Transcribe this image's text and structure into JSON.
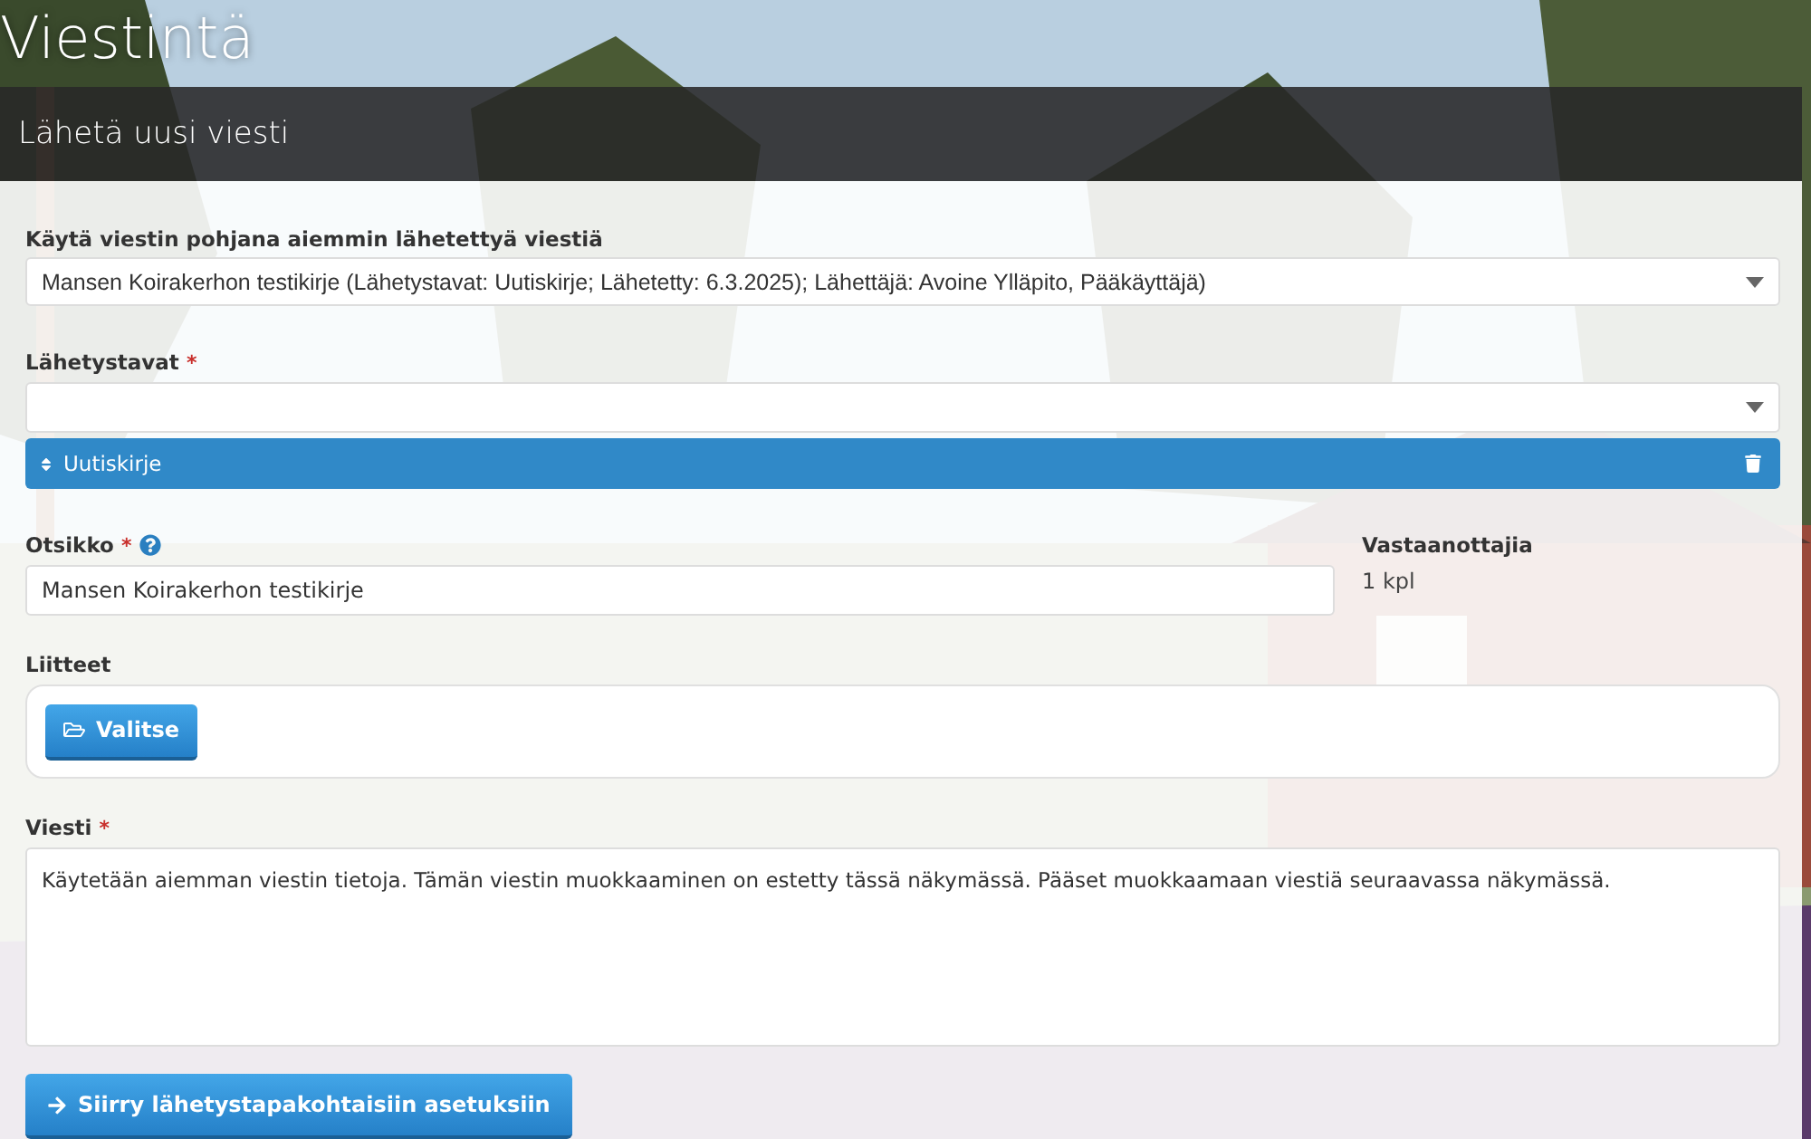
{
  "page_title": "Viestintä",
  "panel": {
    "title": "Lähetä uusi viesti"
  },
  "template_select": {
    "label": "Käytä viestin pohjana aiemmin lähetettyä viestiä",
    "value": "Mansen Koirakerhon testikirje (Lähetystavat: Uutiskirje; Lähetetty: 6.3.2025); Lähettäjä: Avoine Ylläpito, Pääkäyttäjä)"
  },
  "send_methods": {
    "label": "Lähetystavat",
    "required_mark": "*",
    "tags": [
      {
        "label": "Uutiskirje"
      }
    ]
  },
  "subject": {
    "label": "Otsikko",
    "required_mark": "*",
    "help": true,
    "value": "Mansen Koirakerhon testikirje"
  },
  "recipients": {
    "label": "Vastaanottajia",
    "value": "1 kpl"
  },
  "attachments": {
    "label": "Liitteet",
    "button": "Valitse"
  },
  "message": {
    "label": "Viesti",
    "required_mark": "*",
    "value": "Käytetään aiemman viestin tietoja. Tämän viestin muokkaaminen on estetty tässä näkymässä. Pääset muokkaamaan viestiä seuraavassa näkymässä."
  },
  "next_button": "Siirry lähetystapakohtaisiin asetuksiin"
}
